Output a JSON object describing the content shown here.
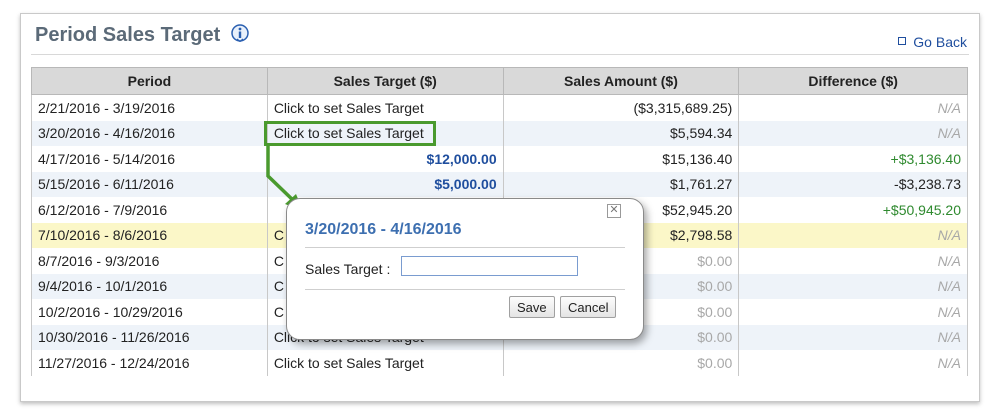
{
  "panel": {
    "title": "Period Sales Target",
    "go_back": "Go Back"
  },
  "table": {
    "headers": [
      "Period",
      "Sales Target ($)",
      "Sales Amount ($)",
      "Difference ($)"
    ],
    "rows": [
      {
        "period": "2/21/2016 - 3/19/2016",
        "target": "Click to set Sales Target",
        "amount": "($3,315,689.25)",
        "diff": "N/A"
      },
      {
        "period": "3/20/2016 - 4/16/2016",
        "target": "Click to set Sales Target",
        "amount": "$5,594.34",
        "diff": "N/A"
      },
      {
        "period": "4/17/2016 - 5/14/2016",
        "target": "$12,000.00",
        "amount": "$15,136.40",
        "diff": "+$3,136.40"
      },
      {
        "period": "5/15/2016 - 6/11/2016",
        "target": "$5,000.00",
        "amount": "$1,761.27",
        "diff": "-$3,238.73"
      },
      {
        "period": "6/12/2016 - 7/9/2016",
        "target": "",
        "amount": "$52,945.20",
        "diff": "+$50,945.20"
      },
      {
        "period": "7/10/2016 - 8/6/2016",
        "target": "C",
        "amount": "$2,798.58",
        "diff": "N/A"
      },
      {
        "period": "8/7/2016 - 9/3/2016",
        "target": "C",
        "amount": "$0.00",
        "diff": "N/A"
      },
      {
        "period": "9/4/2016 - 10/1/2016",
        "target": "C",
        "amount": "$0.00",
        "diff": "N/A"
      },
      {
        "period": "10/2/2016 - 10/29/2016",
        "target": "C",
        "amount": "$0.00",
        "diff": "N/A"
      },
      {
        "period": "10/30/2016 - 11/26/2016",
        "target": "Click to set Sales Target",
        "amount": "$0.00",
        "diff": "N/A"
      },
      {
        "period": "11/27/2016 - 12/24/2016",
        "target": "Click to set Sales Target",
        "amount": "$0.00",
        "diff": "N/A"
      }
    ]
  },
  "popup": {
    "title": "3/20/2016 - 4/16/2016",
    "label": "Sales Target :",
    "input_value": "",
    "save_label": "Save",
    "cancel_label": "Cancel",
    "close_glyph": "✕"
  },
  "colors": {
    "link": "#1f4e9e",
    "highlight_row": "#fbf7c8",
    "alt_row": "#eef3f9",
    "callout": "#4a9a2e",
    "positive": "#2f8a2f",
    "popup_title": "#3d6fb0"
  },
  "icons": {
    "info": "info-icon",
    "go_back": "square-bullet-icon",
    "close": "close-icon"
  }
}
